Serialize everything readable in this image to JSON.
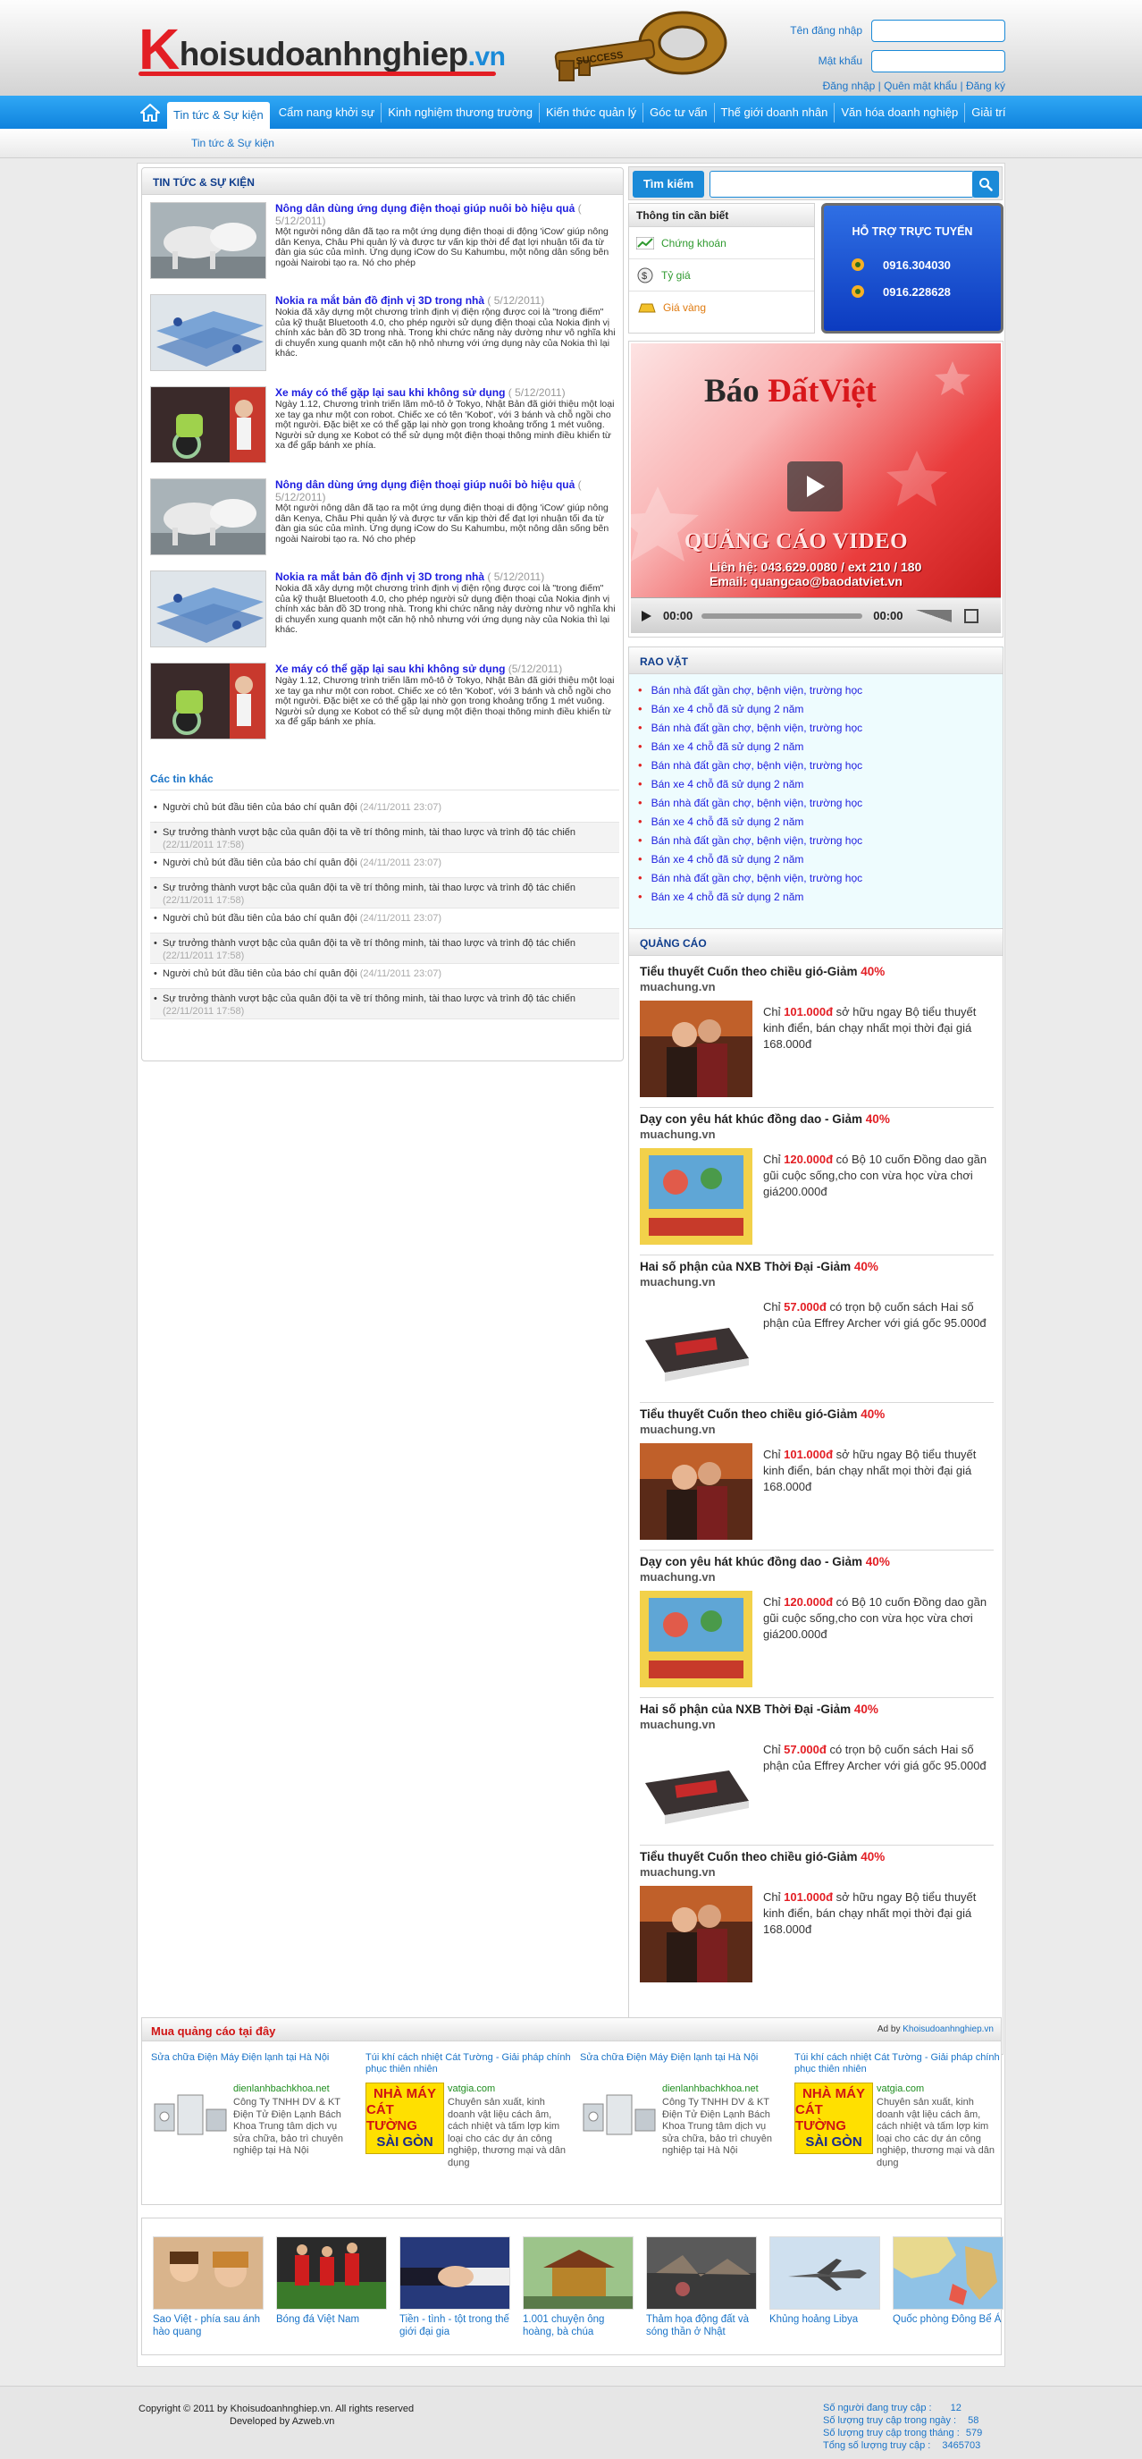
{
  "header": {
    "logo_k": "K",
    "logo_rest": "hoisudoanhnghiep",
    "logo_ext": ".vn",
    "key_text": "SUCCESS",
    "login": {
      "username_label": "Tên đăng nhập",
      "password_label": "Mật khẩu",
      "links": [
        "Đăng nhập",
        "Quên mật khẩu",
        "Đăng ký"
      ]
    }
  },
  "nav": {
    "items": [
      "Tin tức & Sự kiện",
      "Cẩm nang khởi sự",
      "Kinh nghiệm thương trường",
      "Kiến thức quản lý",
      "Góc tư vấn",
      "Thế giới doanh nhân",
      "Văn hóa doanh nghiệp",
      "Giải trí"
    ],
    "active_index": 0,
    "sub_link": "Tin tức & Sự kiện"
  },
  "news": {
    "title": "TIN TỨC & SỰ KIỆN",
    "articles": [
      {
        "title": "Nông dân dùng ứng dụng điện thoại giúp nuôi bò hiệu quả",
        "date": "( 5/12/2011)",
        "excerpt": "Một người nông dân đã tạo ra một ứng dụng điện thoại di động 'iCow' giúp nông dân Kenya, Châu Phi quản lý và được tư vấn kịp thời để đạt lợi nhuận tối đa từ đàn gia súc của mình. Ứng dụng iCow do Su Kahumbu, một nông dân sống bên ngoài Nairobi tạo ra. Nó cho phép",
        "image": "cows"
      },
      {
        "title": "Nokia ra mắt bản đồ định vị 3D trong nhà",
        "date": "( 5/12/2011)",
        "excerpt": "Nokia đã xây dựng một chương trình định vị điện rộng được coi là \"trong điểm\" của kỹ thuật Bluetooth 4.0, cho phép người sử dụng điện thoại của Nokia định vị chính xác bản đồ 3D trong nhà. Trong khi chức năng này dường như vô nghĩa khi di chuyển xung quanh một căn hộ nhỏ nhưng với ứng dụng này của Nokia thì lại khác.",
        "image": "map3d"
      },
      {
        "title": "Xe máy có thể gặp lại sau khi không sử dụng",
        "date": "( 5/12/2011)",
        "excerpt": "Ngày 1.12, Chương trình triển lãm mô-tô ở Tokyo, Nhật Bản đã giới thiệu một loại xe tay ga như một con robot. Chiếc xe có tên 'Kobot', với 3 bánh và chỗ ngồi cho một người. Đặc biệt xe có thể gặp lại nhờ gọn trong khoảng trống 1 mét vuông. Người sử dụng xe Kobot có thể sử dụng một điện thoại thông minh điều khiển từ xa để gấp bánh xe phía.",
        "image": "bike"
      },
      {
        "title": "Nông dân dùng ứng dụng điện thoại giúp nuôi bò hiệu quả",
        "date": "( 5/12/2011)",
        "excerpt": "Một người nông dân đã tạo ra một ứng dụng điện thoại di động 'iCow' giúp nông dân Kenya, Châu Phi quản lý và được tư vấn kịp thời để đạt lợi nhuận tối đa từ đàn gia súc của mình. Ứng dụng iCow do Su Kahumbu, một nông dân sống bên ngoài Nairobi tạo ra. Nó cho phép",
        "image": "cows"
      },
      {
        "title": "Nokia ra mắt bản đồ định vị 3D trong nhà",
        "date": "( 5/12/2011)",
        "excerpt": "Nokia đã xây dựng một chương trình định vị điện rộng được coi là \"trong điểm\" của kỹ thuật Bluetooth 4.0, cho phép người sử dụng điện thoại của Nokia định vị chính xác bản đồ 3D trong nhà. Trong khi chức năng này dường như vô nghĩa khi di chuyển xung quanh một căn hộ nhỏ nhưng với ứng dụng này của Nokia thì lại khác.",
        "image": "map3d"
      },
      {
        "title": "Xe máy có thể gặp lại sau khi không sử dụng",
        "date": "(5/12/2011)",
        "excerpt": "Ngày 1.12, Chương trình triển lãm mô-tô ở Tokyo, Nhật Bản đã giới thiệu một loại xe tay ga như một con robot. Chiếc xe có tên 'Kobot', với 3 bánh và chỗ ngồi cho một người. Đặc biệt xe có thể gặp lại nhờ gọn trong khoảng trống 1 mét vuông. Người sử dụng xe Kobot có thể sử dụng một điện thoại thông minh điều khiển từ xa để gấp bánh xe phía.",
        "image": "bike"
      }
    ],
    "other_title": "Các tin khác",
    "others": [
      {
        "text": "Người chủ bút đầu tiên của báo chí quân đội",
        "date": "(24/11/2011 23:07)"
      },
      {
        "text": "Sự trưởng thành vượt bậc của quân đội ta về trí thông minh, tài thao lược và trình độ tác chiến",
        "date": "(22/11/2011 17:58)"
      },
      {
        "text": "Người chủ bút đầu tiên của báo chí quân đội",
        "date": "(24/11/2011 23:07)"
      },
      {
        "text": "Sự trưởng thành vượt bậc của quân đội ta về trí thông minh, tài thao lược và trình độ tác chiến",
        "date": "(22/11/2011 17:58)"
      },
      {
        "text": "Người chủ bút đầu tiên của báo chí quân đội",
        "date": "(24/11/2011 23:07)"
      },
      {
        "text": "Sự trưởng thành vượt bậc của quân đội ta về trí thông minh, tài thao lược và trình độ tác chiến",
        "date": "(22/11/2011 17:58)"
      },
      {
        "text": "Người chủ bút đầu tiên của báo chí quân đội",
        "date": "(24/11/2011 23:07)"
      },
      {
        "text": "Sự trưởng thành vượt bậc của quân đội ta về trí thông minh, tài thao lược và trình độ tác chiến",
        "date": "(22/11/2011 17:58)"
      }
    ]
  },
  "search": {
    "label": "Tìm kiếm",
    "icon": "search-icon"
  },
  "info": {
    "title": "Thông tin cần biết",
    "items": [
      {
        "label": "Chứng khoán",
        "color": "#2f9a2f",
        "icon": "chart-icon"
      },
      {
        "label": "Tỷ giá",
        "color": "#2f9a2f",
        "icon": "currency-icon"
      },
      {
        "label": "Giá vàng",
        "color": "#e07b10",
        "icon": "gold-icon"
      }
    ]
  },
  "support": {
    "title": "HỖ TRỢ TRỰC TUYẾN",
    "phones": [
      "0916.304030",
      "0916.228628"
    ],
    "icon": "support-icon"
  },
  "video": {
    "brand_plain": "Báo ",
    "brand_red": "ĐấtViệt",
    "ad_text": "QUẢNG CÁO VIDEO",
    "contact_1": "Liên hệ: 043.629.0080 / ext 210 / 180",
    "contact_2": "Email: quangcao@baodatviet.vn",
    "time_current": "00:00",
    "time_total": "00:00"
  },
  "raovat": {
    "title": "RAO VẶT",
    "items": [
      "Bán nhà đất gần chợ, bệnh viện, trường học",
      "Bán xe 4 chỗ đã sử dụng 2 năm",
      "Bán nhà đất gần chợ, bệnh viện, trường học",
      "Bán xe 4 chỗ đã sử dụng 2 năm",
      "Bán nhà đất gần chợ, bệnh viện, trường học",
      "Bán xe 4 chỗ đã sử dụng 2 năm",
      "Bán nhà đất gần chợ, bệnh viện, trường học",
      "Bán xe 4 chỗ đã sử dụng 2 năm",
      "Bán nhà đất gần chợ, bệnh viện, trường học",
      "Bán xe 4 chỗ đã sử dụng 2 năm",
      "Bán nhà đất gần chợ, bệnh viện, trường học",
      "Bán xe 4 chỗ đã sử dụng 2 năm"
    ]
  },
  "quangcao": {
    "title": "QUẢNG CÁO",
    "items": [
      {
        "title": "Tiểu thuyết Cuốn theo chiều gió-Giảm ",
        "pct": "40%",
        "site": "muachung.vn",
        "pre": "Chỉ ",
        "price": "101.000đ",
        "text": " sở hữu ngay Bộ tiểu thuyết kinh điển, bán chạy nhất mọi thời đại giá 168.000đ",
        "image": "gone-wind"
      },
      {
        "title": "Dạy con yêu hát khúc đồng dao - Giảm ",
        "pct": "40%",
        "site": "muachung.vn",
        "pre": "Chỉ ",
        "price": "120.000đ",
        "text": " có Bộ 10 cuốn Đồng dao gần gũi cuộc sống,cho con vừa học vừa chơi giá200.000đ",
        "image": "children-book"
      },
      {
        "title": "Hai số phận của NXB Thời Đại -Giảm ",
        "pct": "40%",
        "site": "muachung.vn",
        "pre": "Chỉ ",
        "price": "57.000đ",
        "text": " có trọn bộ cuốn sách Hai số phận của Effrey Archer với giá gốc 95.000đ",
        "image": "novel-book"
      },
      {
        "title": "Tiểu thuyết Cuốn theo chiều gió-Giảm ",
        "pct": "40%",
        "site": "muachung.vn",
        "pre": "Chỉ ",
        "price": "101.000đ",
        "text": " sở hữu ngay Bộ tiểu thuyết kinh điển, bán chạy nhất mọi thời đại giá 168.000đ",
        "image": "gone-wind"
      },
      {
        "title": "Dạy con yêu hát khúc đồng dao - Giảm ",
        "pct": "40%",
        "site": "muachung.vn",
        "pre": "Chỉ ",
        "price": "120.000đ",
        "text": " có Bộ 10 cuốn Đồng dao gần gũi cuộc sống,cho con vừa học vừa chơi giá200.000đ",
        "image": "children-book"
      },
      {
        "title": "Hai số phận của NXB Thời Đại -Giảm ",
        "pct": "40%",
        "site": "muachung.vn",
        "pre": "Chỉ ",
        "price": "57.000đ",
        "text": " có trọn bộ cuốn sách Hai số phận của Effrey Archer với giá gốc 95.000đ",
        "image": "novel-book"
      },
      {
        "title": "Tiểu thuyết Cuốn theo chiều gió-Giảm ",
        "pct": "40%",
        "site": "muachung.vn",
        "pre": "Chỉ ",
        "price": "101.000đ",
        "text": " sở hữu ngay Bộ tiểu thuyết kinh điển, bán chạy nhất mọi thời đại giá 168.000đ",
        "image": "gone-wind"
      }
    ]
  },
  "ads": {
    "title": "Mua quảng cáo tại đây",
    "by_prefix": "Ad by ",
    "by_link": "Khoisudoanhnghiep.vn",
    "units": [
      {
        "head": "Sửa chữa Điện Máy Điện lạnh tại Hà Nội",
        "domain": "dienlanhbachkhoa.net",
        "body": "Công Ty TNHH DV & KT Điện Tử Điện Lạnh Bách Khoa Trung tâm dịch vụ sửa chữa, bảo trì chuyên nghiệp tại Hà Nội",
        "image": "appliances"
      },
      {
        "head": "Túi khí cách nhiệt Cát Tường - Giải pháp chính phục thiên nhiên",
        "domain": "vatgia.com",
        "body": "Chuyên sản xuất, kinh doanh vật liệu cách âm, cách nhiệt và tấm lợp kim loại cho các dự án công nghiệp, thương mại và dân dụng",
        "image": "cat-tuong",
        "img_line1": "NHÀ MÁY",
        "img_line2": "CÁT TƯỜNG",
        "img_line3": "SÀI GÒN"
      },
      {
        "head": "Sửa chữa Điện Máy Điện lạnh tại Hà Nội",
        "domain": "dienlanhbachkhoa.net",
        "body": "Công Ty TNHH DV & KT Điện Tử Điện Lạnh Bách Khoa Trung tâm dịch vụ sửa chữa, bảo trì chuyên nghiệp tại Hà Nội",
        "image": "appliances"
      },
      {
        "head": "Túi khí cách nhiệt Cát Tường - Giải pháp chính phục thiên nhiên",
        "domain": "vatgia.com",
        "body": "Chuyên sản xuất, kinh doanh vật liệu cách âm, cách nhiệt và tấm lợp kim loại cho các dự án công nghiệp, thương mại và dân dụng",
        "image": "cat-tuong",
        "img_line1": "NHÀ MÁY",
        "img_line2": "CÁT TƯỜNG",
        "img_line3": "SÀI GÒN"
      }
    ]
  },
  "gallery": {
    "items": [
      {
        "caption": "Sao Việt - phía sau ánh hào quang",
        "image": "celebrities"
      },
      {
        "caption": "Bóng đá Việt Nam",
        "image": "football"
      },
      {
        "caption": "Tiền - tình - tột trong thế giới đại gia",
        "image": "handshake"
      },
      {
        "caption": "1.001 chuyện ông hoàng, bà chúa",
        "image": "temple"
      },
      {
        "caption": "Thảm họa động đất và sóng thần ở Nhật",
        "image": "disaster"
      },
      {
        "caption": "Khủng hoảng Libya",
        "image": "jet"
      },
      {
        "caption": "Quốc phòng Đông Bể Á",
        "image": "map"
      }
    ]
  },
  "footer": {
    "copyright": "Copyright © 2011 by Khoisudoanhnghiep.vn. All rights reserved",
    "developed": "Developed by Azweb.vn",
    "stats": [
      {
        "label": "Số người đang truy cập :",
        "value": "12"
      },
      {
        "label": "Số lượng truy cập trong ngày :",
        "value": "58"
      },
      {
        "label": "Số lượng truy cập trong tháng :",
        "value": "579"
      },
      {
        "label": "Tổng số lượng truy cập :",
        "value": "3465703"
      }
    ]
  }
}
